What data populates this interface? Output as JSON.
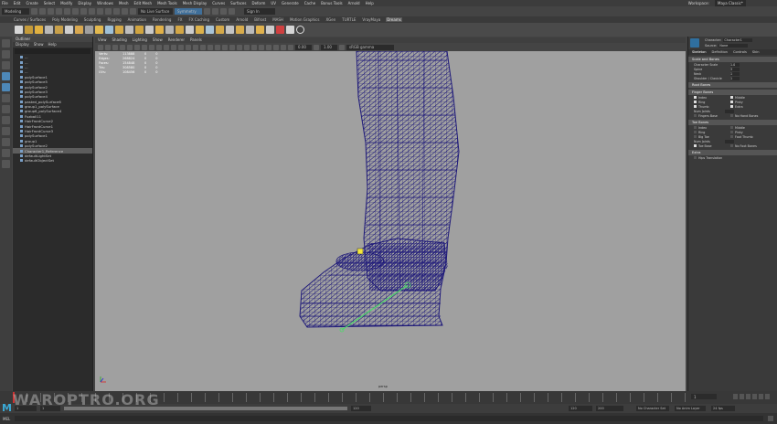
{
  "menubar": {
    "items": [
      "File",
      "Edit",
      "Create",
      "Select",
      "Modify",
      "Display",
      "Windows",
      "Mesh",
      "Edit Mesh",
      "Mesh Tools",
      "Mesh Display",
      "Curves",
      "Surfaces",
      "Deform",
      "UV",
      "Generate",
      "Cache",
      "Bonus Tools",
      "Arnold",
      "Help"
    ],
    "workspace_label": "Workspace:",
    "workspace_value": "Maya Classic*"
  },
  "statusline": {
    "mode": "Modeling",
    "no_live": "No Live Surface",
    "symmetry": "Symmetry",
    "sign_in": "Sign In"
  },
  "shelf_tabs": [
    "Curves / Surfaces",
    "Poly Modeling",
    "Sculpting",
    "Rigging",
    "Animation",
    "Rendering",
    "FX",
    "FX Caching",
    "Custom",
    "Arnold",
    "Bifrost",
    "MASH",
    "Motion Graphics",
    "XGen",
    "TURTLE",
    "VrayMaya",
    "Dreams"
  ],
  "active_shelf": "Dreams",
  "outliner": {
    "title": "Outliner",
    "menu": [
      "Display",
      "Show",
      "Help"
    ],
    "items": [
      "...",
      "...",
      "...",
      "...",
      "polySurface1",
      "polySurface5",
      "polySurface2",
      "polySurface3",
      "polySurface4",
      "pasted_polySurface6",
      "group1_polySurface",
      "group6_polySurface4",
      "Fuzball11",
      "HairFrontCurve2",
      "HairFrontCurve1",
      "HairFrontCurve3",
      "polySurface1",
      "group1",
      "polySurface2",
      "Character1_Reference",
      "defaultLightSet",
      "defaultObjectSet"
    ],
    "selected_index": 19
  },
  "panel_menu": [
    "View",
    "Shading",
    "Lighting",
    "Show",
    "Renderer",
    "Panels"
  ],
  "panel_toolbar": {
    "value1": "0.00",
    "value2": "1.00",
    "colorspace": "sRGB gamma"
  },
  "hud": [
    [
      "Verts:",
      "113888",
      "0",
      "0"
    ],
    [
      "Edges:",
      "268824",
      "0",
      "0"
    ],
    [
      "Faces:",
      "154848",
      "0",
      "0"
    ],
    [
      "Tris:",
      "308580",
      "0",
      "0"
    ],
    [
      "UVs:",
      "108456",
      "0",
      "0"
    ]
  ],
  "viewport": {
    "camera": "persp",
    "background": "#a0a0a0",
    "wire_color": "#1f1a7a",
    "joint_color": "#4cd86a"
  },
  "attr_editor": {
    "character_label": "Character:",
    "character_value": "Character1",
    "source_label": "Source:",
    "source_value": "None",
    "tabs": [
      "Skeleton",
      "Definition",
      "Controls",
      "Skin"
    ],
    "section_scale": "Scale and Bones",
    "fields": [
      {
        "label": "Character Scale",
        "value": "1.0"
      },
      {
        "label": "Spine",
        "value": "3"
      },
      {
        "label": "Neck",
        "value": "1"
      },
      {
        "label": "Shoulder / Clavicle",
        "value": "1"
      }
    ],
    "section_root": "Root Bones",
    "section_finger": "Finger Bones",
    "finger_checks": [
      [
        "Index",
        "Middle"
      ],
      [
        "Ring",
        "Pinky"
      ],
      [
        "Thumb",
        "Extra"
      ]
    ],
    "hand_label": "Num Joints",
    "finger_base_row": [
      "Fingers Base",
      "No Hand Bones"
    ],
    "section_toe": "Toe Bones",
    "toe_checks": [
      [
        "Index",
        "Middle"
      ],
      [
        "Ring",
        "Pinky"
      ],
      [
        "Big Toe",
        "Foot Thumb"
      ]
    ],
    "toe_extra": "Num Joints",
    "toe_base_row": [
      "Toe Base",
      "No Foot Bones"
    ],
    "section_extra": "Extra",
    "extra_label": "Hips Translation"
  },
  "time": {
    "ticks": [
      "1",
      "5",
      "10",
      "15",
      "20",
      "25",
      "30",
      "35",
      "40",
      "45",
      "50",
      "55",
      "60",
      "65",
      "70",
      "75",
      "80",
      "85",
      "90",
      "95",
      "100",
      "105",
      "110",
      "115",
      "120"
    ],
    "current": "1",
    "start": "1",
    "range_start": "1",
    "range_end": "120",
    "end": "120",
    "end2": "200",
    "char_set": "No Character Set",
    "anim_layer": "No Anim Layer",
    "fps": "24 fps"
  },
  "cmd": {
    "lang": "MEL"
  },
  "watermark": "WAROPTRO.ORG"
}
